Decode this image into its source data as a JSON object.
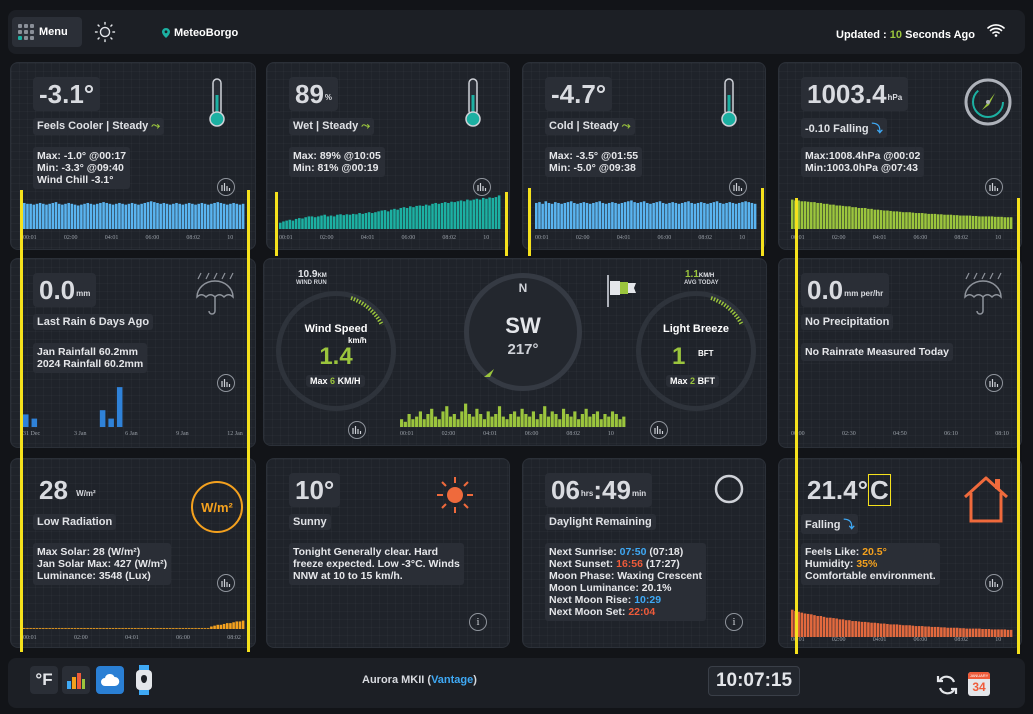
{
  "topbar": {
    "menu_label": "Menu",
    "station": "MeteoBorgo",
    "updated_prefix": "Updated :",
    "updated_value": "10",
    "updated_suffix": "Seconds Ago"
  },
  "temperature": {
    "value": "-3.1°",
    "status": "Feels Cooler | Steady",
    "max": "Max: -1.0° @00:17",
    "min": "Min: -3.3° @09:40",
    "extra": "Wind Chill -3.1°",
    "chart_values": [
      0.62,
      0.6,
      0.6,
      0.58,
      0.6,
      0.62,
      0.6,
      0.58,
      0.6,
      0.62,
      0.64,
      0.6,
      0.58,
      0.6,
      0.62,
      0.6,
      0.58,
      0.56,
      0.58,
      0.6,
      0.62,
      0.6,
      0.58,
      0.6,
      0.62,
      0.64,
      0.62,
      0.6,
      0.58,
      0.6,
      0.62,
      0.6,
      0.58,
      0.6,
      0.62,
      0.6,
      0.58,
      0.6,
      0.62,
      0.64,
      0.66,
      0.64,
      0.62,
      0.6,
      0.62,
      0.6,
      0.58,
      0.6,
      0.62,
      0.6,
      0.58,
      0.6,
      0.62,
      0.6,
      0.58,
      0.6,
      0.62,
      0.6,
      0.58,
      0.6,
      0.62,
      0.64,
      0.62,
      0.6,
      0.58,
      0.6,
      0.62,
      0.6,
      0.58,
      0.6
    ],
    "xticks": [
      "00:01",
      "02:00",
      "04:01",
      "06:00",
      "08:02",
      "10"
    ]
  },
  "humidity": {
    "value": "89",
    "unit": "%",
    "status": "Wet | Steady",
    "max": "Max: 89% @10:05",
    "min": "Min: 81% @00:19",
    "chart_values": [
      0.15,
      0.18,
      0.2,
      0.22,
      0.2,
      0.24,
      0.26,
      0.25,
      0.28,
      0.3,
      0.3,
      0.28,
      0.3,
      0.32,
      0.34,
      0.3,
      0.32,
      0.3,
      0.34,
      0.35,
      0.33,
      0.35,
      0.34,
      0.36,
      0.35,
      0.38,
      0.36,
      0.38,
      0.4,
      0.38,
      0.4,
      0.42,
      0.44,
      0.45,
      0.42,
      0.46,
      0.48,
      0.46,
      0.5,
      0.52,
      0.5,
      0.54,
      0.52,
      0.55,
      0.56,
      0.55,
      0.58,
      0.56,
      0.6,
      0.62,
      0.6,
      0.62,
      0.64,
      0.62,
      0.65,
      0.64,
      0.66,
      0.68,
      0.66,
      0.7,
      0.68,
      0.7,
      0.72,
      0.7,
      0.74,
      0.72,
      0.75,
      0.74,
      0.76,
      0.8
    ],
    "xticks": [
      "00:01",
      "02:00",
      "04:01",
      "06:00",
      "08:02",
      "10"
    ]
  },
  "dewpoint": {
    "value": "-4.7°",
    "status": "Cold | Steady",
    "max": "Max: -3.5° @01:55",
    "min": "Min: -5.0° @09:38",
    "chart_values": [
      0.62,
      0.64,
      0.6,
      0.66,
      0.62,
      0.6,
      0.64,
      0.62,
      0.6,
      0.62,
      0.64,
      0.66,
      0.62,
      0.6,
      0.62,
      0.64,
      0.62,
      0.6,
      0.62,
      0.64,
      0.66,
      0.62,
      0.6,
      0.62,
      0.64,
      0.62,
      0.6,
      0.62,
      0.64,
      0.66,
      0.68,
      0.64,
      0.62,
      0.64,
      0.66,
      0.62,
      0.6,
      0.62,
      0.64,
      0.66,
      0.62,
      0.6,
      0.62,
      0.64,
      0.62,
      0.6,
      0.62,
      0.64,
      0.66,
      0.62,
      0.6,
      0.62,
      0.64,
      0.62,
      0.6,
      0.62,
      0.64,
      0.66,
      0.62,
      0.6,
      0.62,
      0.64,
      0.62,
      0.6,
      0.62,
      0.64,
      0.66,
      0.64,
      0.62,
      0.6
    ],
    "xticks": [
      "00:01",
      "02:00",
      "04:01",
      "06:00",
      "08:02",
      "10"
    ]
  },
  "pressure": {
    "value": "1003.4",
    "unit": "hPa",
    "status": "-0.10 Falling",
    "max": "Max:1008.4hPa @00:02",
    "min": "Min:1003.0hPa @07:43",
    "chart_values": [
      0.7,
      0.68,
      0.68,
      0.66,
      0.66,
      0.65,
      0.64,
      0.64,
      0.62,
      0.62,
      0.6,
      0.6,
      0.58,
      0.58,
      0.56,
      0.56,
      0.55,
      0.54,
      0.54,
      0.52,
      0.52,
      0.5,
      0.5,
      0.5,
      0.48,
      0.48,
      0.46,
      0.46,
      0.45,
      0.44,
      0.44,
      0.43,
      0.42,
      0.42,
      0.41,
      0.4,
      0.4,
      0.4,
      0.39,
      0.38,
      0.38,
      0.38,
      0.37,
      0.36,
      0.36,
      0.36,
      0.35,
      0.35,
      0.34,
      0.34,
      0.34,
      0.33,
      0.33,
      0.32,
      0.32,
      0.32,
      0.32,
      0.31,
      0.31,
      0.3,
      0.3,
      0.3,
      0.3,
      0.3,
      0.29,
      0.29,
      0.29,
      0.28,
      0.28,
      0.28
    ],
    "xticks": [
      "00:01",
      "02:00",
      "04:01",
      "06:00",
      "08:02",
      "10"
    ]
  },
  "rain": {
    "value": "0.0",
    "unit": "mm",
    "status": "Last Rain 6 Days Ago",
    "line1": "Jan Rainfall 60.2mm",
    "line2": "2024 Rainfall 60.2mm",
    "bars": [
      0.3,
      0.2,
      0,
      0,
      0,
      0,
      0,
      0,
      0,
      0.4,
      0.2,
      0.95,
      0,
      0,
      0,
      0,
      0,
      0,
      0,
      0,
      0,
      0,
      0,
      0,
      0,
      0
    ],
    "xticks": [
      "31 Dec",
      "3 Jan",
      "6 Jan",
      "9 Jan",
      "12 Jan"
    ]
  },
  "wind": {
    "run_value": "10.9",
    "run_unit": "KM",
    "run_label": "WIND RUN",
    "avg_value": "1.1",
    "avg_unit": "KM/H",
    "avg_label": "AVG TODAY",
    "speed_title": "Wind Speed",
    "speed_unit": "km/h",
    "speed_value": "1.4",
    "speed_max_prefix": "Max",
    "speed_max_value": "6",
    "speed_max_unit": "KM/H",
    "compass_n": "N",
    "direction": "SW",
    "degrees": "217°",
    "beaufort_title": "Light Breeze",
    "beaufort_value": "1",
    "beaufort_unit": "BFT",
    "beaufort_max_prefix": "Max",
    "beaufort_max_value": "2",
    "beaufort_max_unit": "BFT",
    "chart_values": [
      0.3,
      0.2,
      0.5,
      0.3,
      0.4,
      0.6,
      0.3,
      0.5,
      0.7,
      0.4,
      0.3,
      0.6,
      0.8,
      0.4,
      0.5,
      0.3,
      0.6,
      0.9,
      0.5,
      0.4,
      0.7,
      0.5,
      0.3,
      0.6,
      0.4,
      0.5,
      0.8,
      0.4,
      0.3,
      0.5,
      0.6,
      0.4,
      0.7,
      0.5,
      0.4,
      0.6,
      0.3,
      0.5,
      0.8,
      0.4,
      0.6,
      0.5,
      0.3,
      0.7,
      0.5,
      0.4,
      0.6,
      0.3,
      0.5,
      0.7,
      0.4,
      0.5,
      0.6,
      0.3,
      0.5,
      0.4,
      0.6,
      0.5,
      0.3,
      0.4
    ],
    "xticks": [
      "00:01",
      "02:00",
      "04:01",
      "06:00",
      "08:02",
      "10"
    ]
  },
  "rainrate": {
    "value": "0.0",
    "unit": "mm per/hr",
    "status": "No Precipitation",
    "line1": "No Rainrate Measured Today",
    "xticks": [
      "00:00",
      "02:30",
      "04:50",
      "06:10",
      "08:10"
    ]
  },
  "solar": {
    "value": "28",
    "unit": "W/m²",
    "badge": "W/m²",
    "status": "Low Radiation",
    "line1": "Max Solar: 28 (W/m²)",
    "line2": "Jan Solar Max: 427 (W/m²)",
    "line3": "Luminance: 3548 (Lux)",
    "chart_values": [
      0.02,
      0.02,
      0.02,
      0.02,
      0.02,
      0.02,
      0.02,
      0.02,
      0.02,
      0.02,
      0.02,
      0.02,
      0.02,
      0.02,
      0.02,
      0.02,
      0.02,
      0.02,
      0.02,
      0.02,
      0.02,
      0.02,
      0.02,
      0.02,
      0.02,
      0.02,
      0.02,
      0.02,
      0.02,
      0.02,
      0.02,
      0.02,
      0.02,
      0.02,
      0.02,
      0.02,
      0.02,
      0.02,
      0.02,
      0.02,
      0.02,
      0.02,
      0.02,
      0.02,
      0.02,
      0.02,
      0.02,
      0.02,
      0.02,
      0.02,
      0.02,
      0.02,
      0.02,
      0.02,
      0.02,
      0.02,
      0.02,
      0.02,
      0.02,
      0.06,
      0.08,
      0.1,
      0.1,
      0.12,
      0.14,
      0.14,
      0.16,
      0.18,
      0.18,
      0.2
    ],
    "xticks": [
      "00:01",
      "02:00",
      "04:01",
      "06:00",
      "08:02"
    ]
  },
  "forecast": {
    "value": "10°",
    "status": "Sunny",
    "text1": "Tonight Generally clear. Hard",
    "text2": "freeze expected. Low -3°C. Winds",
    "text3": "NNW at 10 to 15 km/h."
  },
  "daylight": {
    "hours": "06",
    "hours_unit": "hrs",
    "minutes": ":49",
    "minutes_unit": "min",
    "status": "Daylight Remaining",
    "sunrise_label": "Next Sunrise:",
    "sunrise_time": "07:50",
    "sunrise_extra": "(07:18)",
    "sunset_label": "Next Sunset:",
    "sunset_time": "16:56",
    "sunset_extra": "(17:27)",
    "moon_phase": "Moon Phase: Waxing Crescent",
    "moon_lum": "Moon Luminance: 20.1%",
    "moonrise_label": "Next Moon Rise:",
    "moonrise_time": "10:29",
    "moonset_label": "Next Moon Set:",
    "moonset_time": "22:04"
  },
  "indoor": {
    "value": "21.4°",
    "unit_letter": "C",
    "status": "Falling",
    "feels_label": "Feels Like:",
    "feels_value": "20.5°",
    "humidity_label": "Humidity:",
    "humidity_value": "35%",
    "line3": "Comfortable environment.",
    "chart_values": [
      0.65,
      0.62,
      0.6,
      0.58,
      0.56,
      0.55,
      0.54,
      0.52,
      0.5,
      0.5,
      0.48,
      0.46,
      0.46,
      0.45,
      0.44,
      0.42,
      0.42,
      0.4,
      0.4,
      0.38,
      0.38,
      0.37,
      0.36,
      0.36,
      0.35,
      0.34,
      0.34,
      0.33,
      0.32,
      0.32,
      0.31,
      0.3,
      0.3,
      0.3,
      0.29,
      0.28,
      0.28,
      0.28,
      0.27,
      0.26,
      0.26,
      0.26,
      0.25,
      0.25,
      0.24,
      0.24,
      0.24,
      0.23,
      0.23,
      0.22,
      0.22,
      0.22,
      0.22,
      0.21,
      0.21,
      0.2,
      0.2,
      0.2,
      0.2,
      0.2,
      0.19,
      0.19,
      0.19,
      0.18,
      0.18,
      0.18,
      0.18,
      0.18,
      0.17,
      0.17
    ],
    "xticks": [
      "00:01",
      "02:00",
      "04:01",
      "06:00",
      "08:02",
      "10"
    ]
  },
  "footer": {
    "unit_toggle": "°F",
    "device_name": "Aurora MKII (",
    "device_link": "Vantage",
    "device_close": ")",
    "clock": "10:07:15",
    "calendar_day": "34",
    "calendar_top": "JANUARY"
  },
  "colors": {
    "blue": "#5ab4f0",
    "teal": "#1cb0a2",
    "green": "#9bc53d",
    "orange": "#ef6a3c",
    "highlight": "#f5e11c"
  }
}
